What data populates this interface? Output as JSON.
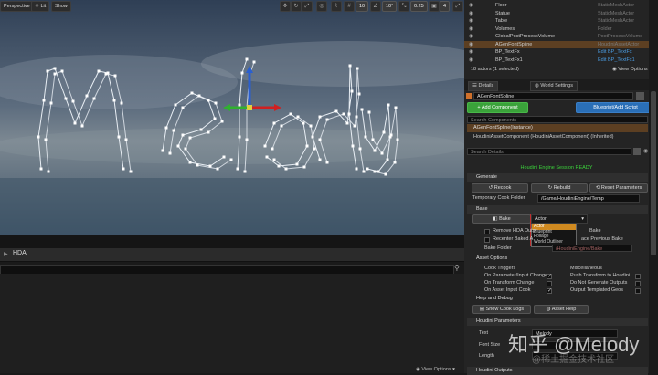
{
  "viewport": {
    "perspective_label": "Perspective",
    "lit_label": "Lit",
    "show_label": "Show",
    "grid_snap": "10",
    "rotation_snap": "10°",
    "scale_snap": "0.25",
    "camera_speed": "4",
    "spline_text": "Melody"
  },
  "outliner": {
    "rows": [
      {
        "name": "Floor",
        "type": "StaticMeshActor",
        "selected": false
      },
      {
        "name": "Statue",
        "type": "StaticMeshActor",
        "selected": false
      },
      {
        "name": "Table",
        "type": "StaticMeshActor",
        "selected": false
      },
      {
        "name": "Volumes",
        "type": "Folder",
        "selected": false
      },
      {
        "name": "GlobalPostProcessVolume",
        "type": "PostProcessVolume",
        "selected": false
      },
      {
        "name": "AGenFontSpline",
        "type": "HoudiniAssetActor",
        "selected": true
      },
      {
        "name": "BP_TextFx",
        "type": "Edit BP_TextFx",
        "selected": false
      },
      {
        "name": "BP_TextFx1",
        "type": "Edit BP_TextFx1",
        "selected": false
      }
    ],
    "count_label": "18 actors (1 selected)",
    "view_options": "View Options"
  },
  "tabs": {
    "details": "Details",
    "world_settings": "World Settings"
  },
  "details": {
    "actor_name": "AGenFontSpline",
    "add_component": "+ Add Component",
    "blueprint_script": "Blueprint/Add Script",
    "search_components_placeholder": "Search Components",
    "instance_label": "AGenFontSpline(Instance)",
    "component_label": "HoudiniAssetComponent (HoudiniAssetComponent) (Inherited)",
    "search_details_placeholder": "Search Details"
  },
  "houdini": {
    "session_status": "Houdini Engine Session READY",
    "generate_section": "Generate",
    "recook": "Recook",
    "rebuild": "Rebuild",
    "reset_parameters": "Reset Parameters",
    "temp_cook_folder_label": "Temporary Cook Folder",
    "temp_cook_folder_value": "/Game/HoudiniEngine/Temp",
    "bake_section": "Bake",
    "bake_button": "Bake",
    "bake_type_value": "Actor",
    "bake_options": [
      "Actor",
      "Blueprint",
      "Foliage",
      "World Outliner"
    ],
    "remove_hda_label": "Remove HDA Outp",
    "recenter_label": "Recenter Baked A",
    "bake_right_label": "Bake",
    "replace_previous_label": "ace Previous Bake",
    "bake_folder_label": "Bake Folder",
    "bake_folder_placeholder": "/HoudiniEngine/Bake",
    "asset_options_section": "Asset Options",
    "cook_triggers_label": "Cook Triggers",
    "miscellaneous_label": "Miscellaneous",
    "on_param_change": "On Parameter/Input Change",
    "on_transform_change": "On Transform Change",
    "on_asset_input_cook": "On Asset Input Cook",
    "push_transform": "Push Transform to Houdini",
    "do_not_generate": "Do Not Generate Outputs",
    "output_templated": "Output Templated Geos",
    "help_section": "Help and Debug",
    "show_cook_logs": "Show Cook Logs",
    "asset_help": "Asset Help",
    "params_section": "Houdini Parameters",
    "param_text_label": "Text",
    "param_text_value": "Melody",
    "param_font_size_label": "Font Size",
    "param_length_label": "Length",
    "outputs_section": "Houdini Outputs"
  },
  "hda_panel": {
    "title": "HDA",
    "view_options": "View Options"
  },
  "watermark": {
    "main": "知乎 @Melody",
    "sub": "@稀土掘金技术社区"
  },
  "colors": {
    "accent_green": "#3aa23a",
    "accent_blue": "#2a6fb7",
    "status_green": "#3bd23b",
    "selection": "#5c3f22"
  }
}
